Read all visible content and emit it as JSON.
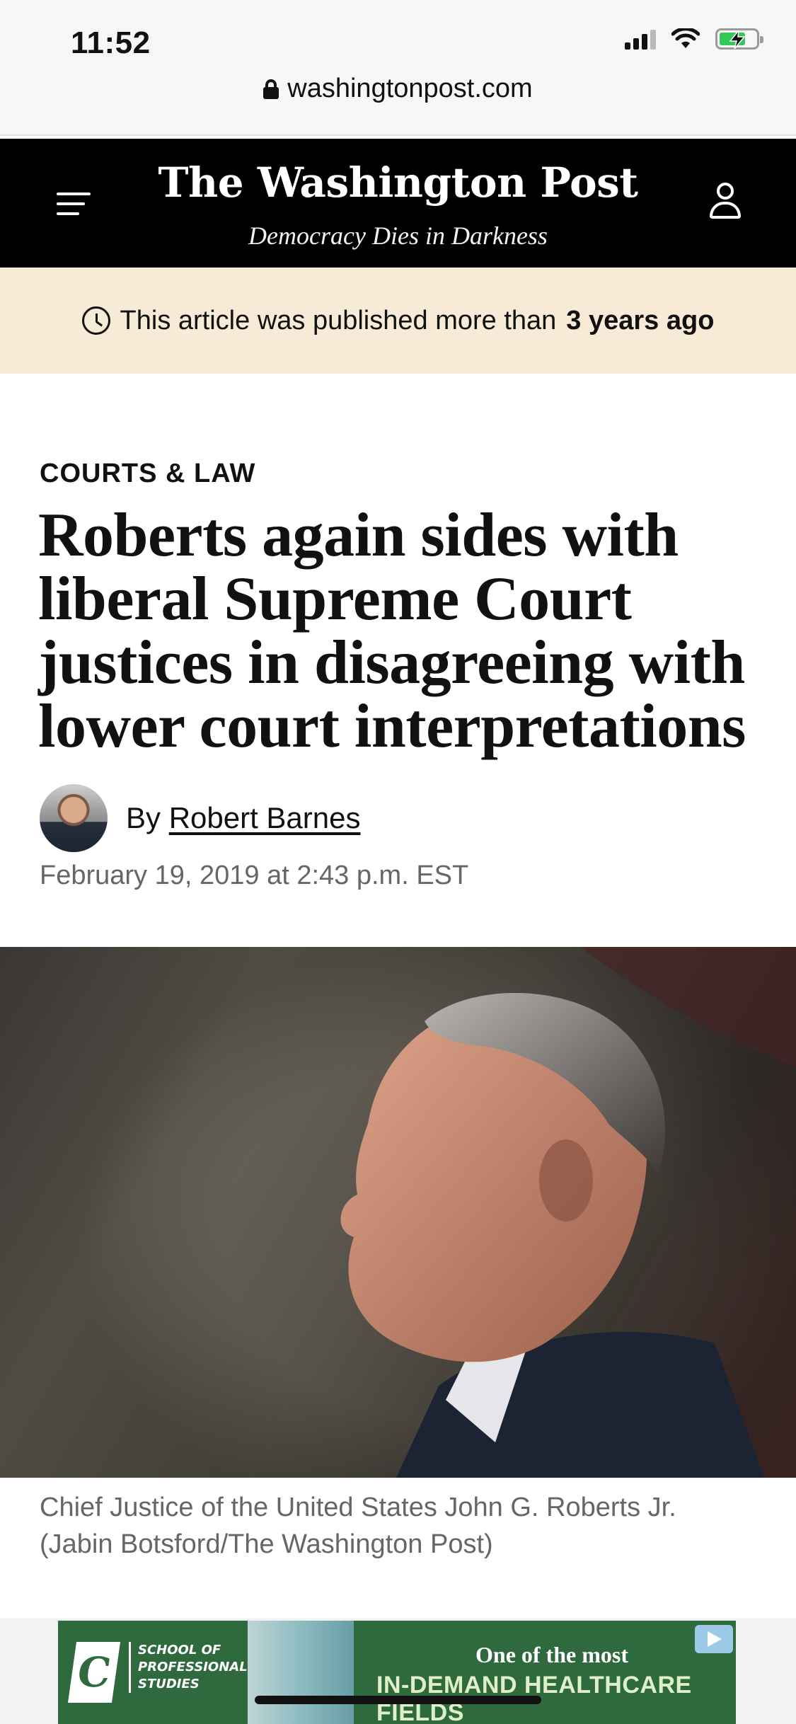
{
  "status_bar": {
    "time": "11:52",
    "battery_charging": true
  },
  "browser": {
    "url": "washingtonpost.com"
  },
  "masthead": {
    "logo": "The Washington Post",
    "tagline": "Democracy Dies in Darkness"
  },
  "notice": {
    "text": "This article was published more than",
    "emphasis": "3 years ago"
  },
  "article": {
    "section": "COURTS & LAW",
    "headline": "Roberts again sides with liberal Supreme Court justices in disagreeing with lower court interpretations",
    "by_prefix": "By",
    "author": "Robert Barnes",
    "date": "February 19, 2019 at 2:43 p.m. EST",
    "caption": "Chief Justice of the United States John G. Roberts Jr. (Jabin Botsford/The Washington Post)"
  },
  "ad": {
    "school": [
      "SCHOOL OF",
      "PROFESSIONAL",
      "STUDIES"
    ],
    "line1": "One of the most",
    "line2": "IN-DEMAND HEALTHCARE FIELDS"
  },
  "colors": {
    "notice_bg": "#f7ead6",
    "masthead_bg": "#000000",
    "ad_bg": "#2f6a3e"
  }
}
